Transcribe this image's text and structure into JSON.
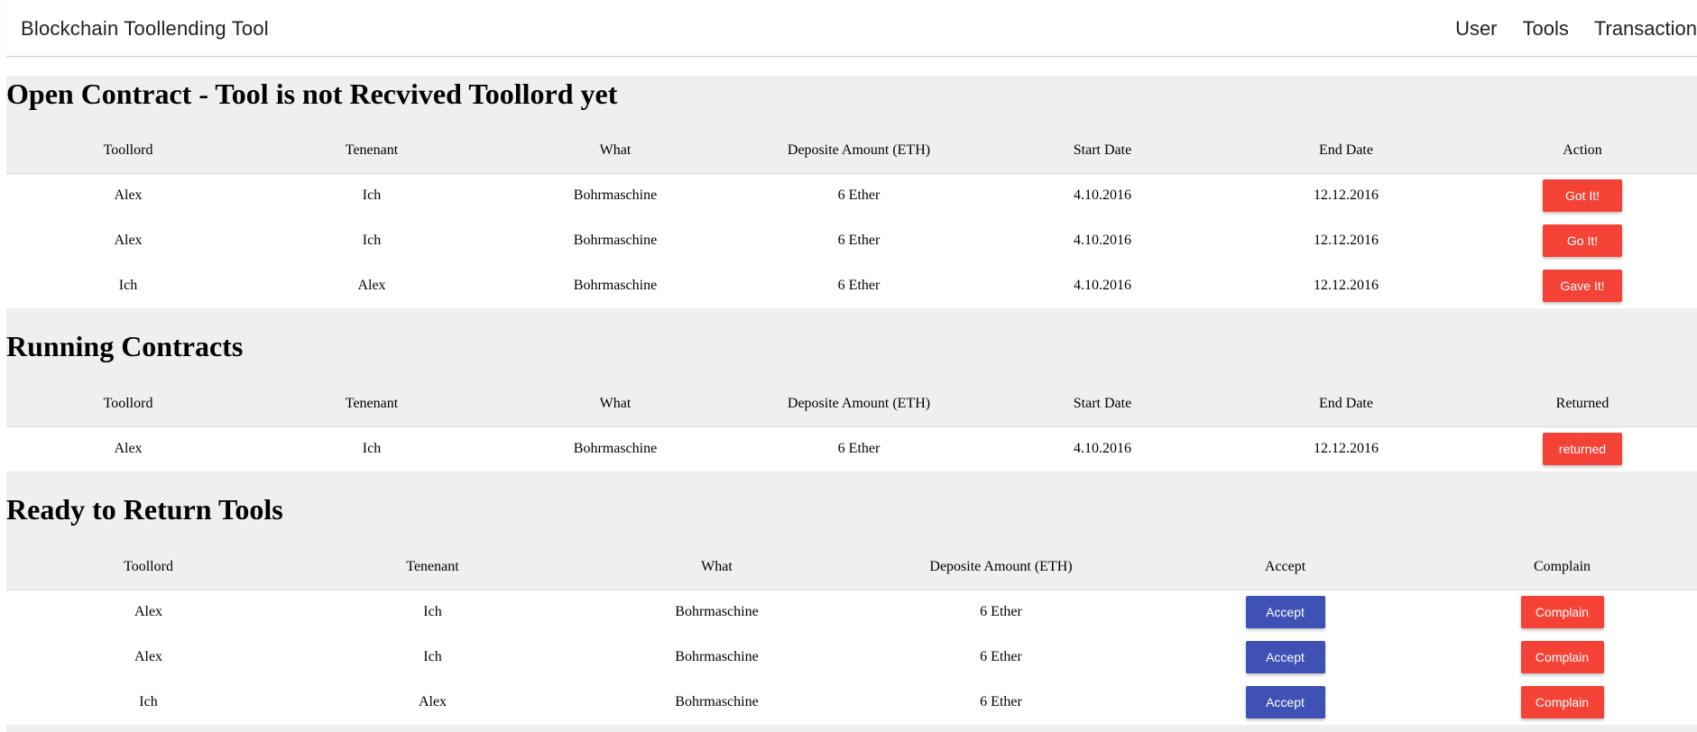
{
  "nav": {
    "brand": "Blockchain Toollending Tool",
    "links": [
      "User",
      "Tools",
      "Transaction"
    ]
  },
  "open_contracts": {
    "title": "Open Contract - Tool is not Recvived Toollord yet",
    "headers": [
      "Toollord",
      "Tenenant",
      "What",
      "Deposite Amount (ETH)",
      "Start Date",
      "End Date",
      "Action"
    ],
    "rows": [
      {
        "toollord": "Alex",
        "tenant": "Ich",
        "what": "Bohrmaschine",
        "deposit": "6 Ether",
        "start": "4.10.2016",
        "end": "12.12.2016",
        "action": "Got It!"
      },
      {
        "toollord": "Alex",
        "tenant": "Ich",
        "what": "Bohrmaschine",
        "deposit": "6 Ether",
        "start": "4.10.2016",
        "end": "12.12.2016",
        "action": "Go It!"
      },
      {
        "toollord": "Ich",
        "tenant": "Alex",
        "what": "Bohrmaschine",
        "deposit": "6 Ether",
        "start": "4.10.2016",
        "end": "12.12.2016",
        "action": "Gave It!"
      }
    ]
  },
  "running_contracts": {
    "title": "Running Contracts",
    "headers": [
      "Toollord",
      "Tenenant",
      "What",
      "Deposite Amount (ETH)",
      "Start Date",
      "End Date",
      "Returned"
    ],
    "rows": [
      {
        "toollord": "Alex",
        "tenant": "Ich",
        "what": "Bohrmaschine",
        "deposit": "6 Ether",
        "start": "4.10.2016",
        "end": "12.12.2016",
        "action": "returned"
      }
    ]
  },
  "ready_to_return": {
    "title": "Ready to Return Tools",
    "headers": [
      "Toollord",
      "Tenenant",
      "What",
      "Deposite Amount (ETH)",
      "Accept",
      "Complain"
    ],
    "rows": [
      {
        "toollord": "Alex",
        "tenant": "Ich",
        "what": "Bohrmaschine",
        "deposit": "6 Ether",
        "accept": "Accept",
        "complain": "Complain"
      },
      {
        "toollord": "Alex",
        "tenant": "Ich",
        "what": "Bohrmaschine",
        "deposit": "6 Ether",
        "accept": "Accept",
        "complain": "Complain"
      },
      {
        "toollord": "Ich",
        "tenant": "Alex",
        "what": "Bohrmaschine",
        "deposit": "6 Ether",
        "accept": "Accept",
        "complain": "Complain"
      }
    ]
  },
  "colors": {
    "red_button": "#f44336",
    "blue_button": "#3f51b5",
    "section_bg": "#efefef"
  }
}
